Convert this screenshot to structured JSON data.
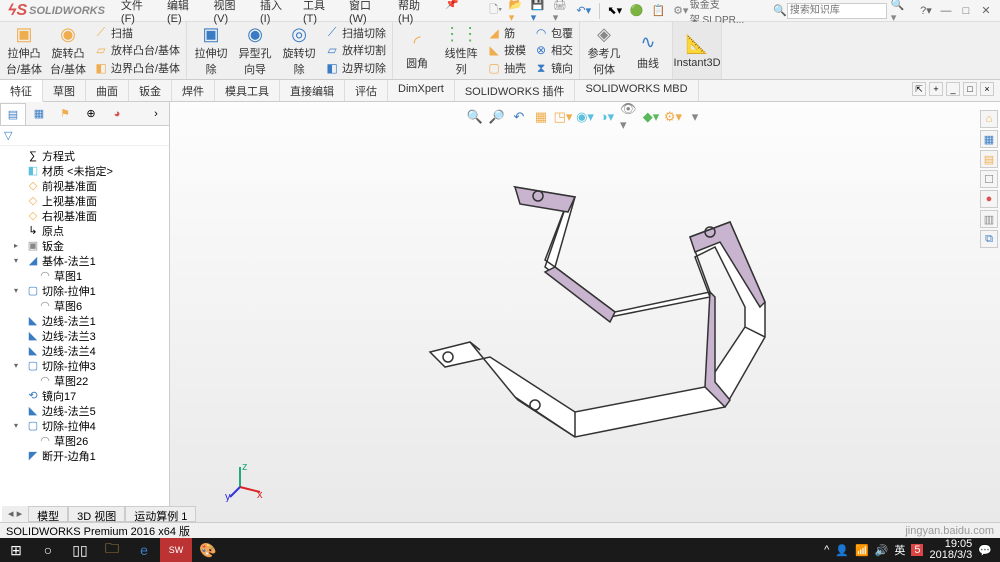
{
  "app": {
    "name": "SOLIDWORKS",
    "doc": "钣金支架.SLDPR..."
  },
  "menu": {
    "file": "文件(F)",
    "edit": "编辑(E)",
    "view": "视图(V)",
    "insert": "插入(I)",
    "tools": "工具(T)",
    "window": "窗口(W)",
    "help": "帮助(H)"
  },
  "search": {
    "placeholder": "搜索知识库"
  },
  "ribbon": {
    "g1": {
      "extrude": "拉伸凸\n台/基体",
      "revolve": "旋转凸\n台/基体",
      "sweep": "扫描",
      "loft": "放样凸台/基体",
      "boundary": "边界凸台/基体"
    },
    "g2": {
      "cut_ext": "拉伸切\n除",
      "wizard": "异型孔\n向导",
      "cut_rev": "旋转切\n除",
      "cut_sweep": "扫描切除",
      "cut_loft": "放样切割",
      "cut_bound": "边界切除"
    },
    "g3": {
      "fillet": "圆角",
      "pattern": "线性阵\n列",
      "rib": "筋",
      "draft": "拔模",
      "shell": "抽壳",
      "wrap": "包覆",
      "intersect": "相交",
      "mirror": "镜向"
    },
    "g4": {
      "refgeom": "参考几\n何体",
      "curves": "曲线"
    },
    "g5": {
      "instant3d": "Instant3D"
    }
  },
  "ftabs": {
    "feature": "特征",
    "sketch": "草图",
    "surface": "曲面",
    "sheetmetal": "钣金",
    "weldment": "焊件",
    "moldtools": "模具工具",
    "directedit": "直接编辑",
    "evaluate": "评估",
    "dimxpert": "DimXpert",
    "swaddins": "SOLIDWORKS 插件",
    "swmbd": "SOLIDWORKS MBD"
  },
  "tree": [
    {
      "lvl": 1,
      "ico": "∑",
      "label": "方程式"
    },
    {
      "lvl": 1,
      "ico": "◧",
      "label": "材质 <未指定>",
      "c": "c-teal"
    },
    {
      "lvl": 1,
      "ico": "◇",
      "label": "前视基准面",
      "c": "c-orange"
    },
    {
      "lvl": 1,
      "ico": "◇",
      "label": "上视基准面",
      "c": "c-orange"
    },
    {
      "lvl": 1,
      "ico": "◇",
      "label": "右视基准面",
      "c": "c-orange"
    },
    {
      "lvl": 1,
      "ico": "↳",
      "label": "原点"
    },
    {
      "lvl": 1,
      "ico": "▣",
      "label": "钣金",
      "tog": "▸",
      "c": "c-gray"
    },
    {
      "lvl": 1,
      "ico": "◢",
      "label": "基体-法兰1",
      "tog": "▾",
      "c": "c-blue"
    },
    {
      "lvl": 2,
      "ico": "◠",
      "label": "草图1",
      "c": "c-gray"
    },
    {
      "lvl": 1,
      "ico": "▢",
      "label": "切除-拉伸1",
      "tog": "▾",
      "c": "c-blue"
    },
    {
      "lvl": 2,
      "ico": "◠",
      "label": "草图6",
      "c": "c-gray"
    },
    {
      "lvl": 1,
      "ico": "◣",
      "label": "边线-法兰1",
      "c": "c-blue"
    },
    {
      "lvl": 1,
      "ico": "◣",
      "label": "边线-法兰3",
      "c": "c-blue"
    },
    {
      "lvl": 1,
      "ico": "◣",
      "label": "边线-法兰4",
      "c": "c-blue"
    },
    {
      "lvl": 1,
      "ico": "▢",
      "label": "切除-拉伸3",
      "tog": "▾",
      "c": "c-blue"
    },
    {
      "lvl": 2,
      "ico": "◠",
      "label": "草图22",
      "c": "c-gray"
    },
    {
      "lvl": 1,
      "ico": "⟲",
      "label": "镜向17",
      "c": "c-blue"
    },
    {
      "lvl": 1,
      "ico": "◣",
      "label": "边线-法兰5",
      "c": "c-blue"
    },
    {
      "lvl": 1,
      "ico": "▢",
      "label": "切除-拉伸4",
      "tog": "▾",
      "c": "c-blue"
    },
    {
      "lvl": 2,
      "ico": "◠",
      "label": "草图26",
      "c": "c-gray"
    },
    {
      "lvl": 1,
      "ico": "◤",
      "label": "断开-边角1",
      "c": "c-blue"
    }
  ],
  "btabs": {
    "model": "模型",
    "view3d": "3D 视图",
    "motion": "运动算例 1"
  },
  "status": {
    "text": "SOLIDWORKS Premium 2016 x64 版",
    "right_faded": "jingyan.baidu.com"
  },
  "tray": {
    "ime": "英",
    "time": "19:05",
    "date": "2018/3/3"
  }
}
